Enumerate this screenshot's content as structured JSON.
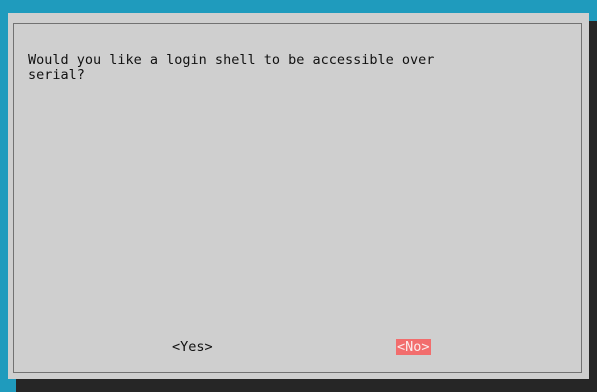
{
  "dialog": {
    "message": "Would you like a login shell to be accessible over\nserial?",
    "buttons": {
      "yes_label": "<Yes>",
      "no_label": "<No>"
    }
  },
  "colors": {
    "background": "#1f9bbd",
    "dialog": "#cfcfcf",
    "selected_button": "#f26d6d",
    "shadow": "#262626"
  }
}
